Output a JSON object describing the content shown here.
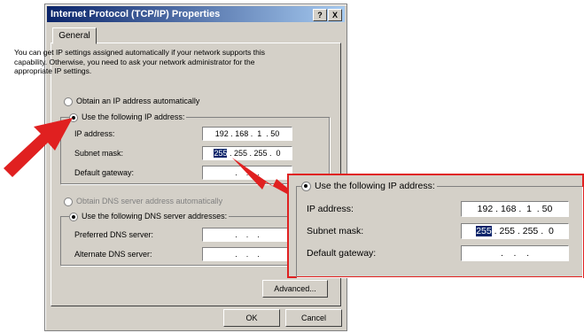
{
  "window": {
    "title": "Internet Protocol (TCP/IP) Properties",
    "help_button": "?",
    "close_button": "X"
  },
  "tabs": [
    {
      "label": "General"
    }
  ],
  "intro_text": "You can get IP settings assigned automatically if your network supports this capability. Otherwise, you need to ask your network administrator for the appropriate IP settings.",
  "ip": {
    "auto_option": "Obtain an IP address automatically",
    "manual_option": "Use the following IP address:",
    "ip_label": "IP address:",
    "ip_value": "192 . 168 .  1  . 50",
    "subnet_label": "Subnet mask:",
    "subnet_first_octet": "255",
    "subnet_rest": " . 255 . 255 .  0",
    "gateway_label": "Default gateway:",
    "gateway_value": " .    .    . "
  },
  "dns": {
    "auto_option": "Obtain DNS server address automatically",
    "manual_option": "Use the following DNS server addresses:",
    "preferred_label": "Preferred DNS server:",
    "alternate_label": "Alternate DNS server:",
    "empty_value": " .    .    . "
  },
  "buttons": {
    "advanced": "Advanced...",
    "ok": "OK",
    "cancel": "Cancel"
  },
  "colors": {
    "callout_red": "#e02020",
    "selection": "#0a246a"
  }
}
